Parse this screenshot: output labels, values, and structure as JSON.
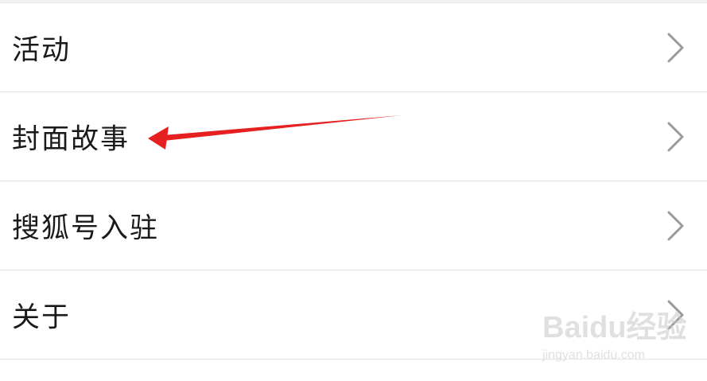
{
  "menu": {
    "items": [
      {
        "label": "活动"
      },
      {
        "label": "封面故事"
      },
      {
        "label": "搜狐号入驻"
      },
      {
        "label": "关于"
      }
    ]
  },
  "watermark": {
    "logo_text": "Baidu经验",
    "url": "jingyan.baidu.com"
  },
  "colors": {
    "annotation_arrow": "#e62020",
    "chevron": "#9a9a9a",
    "divider": "#e4e4e4"
  }
}
